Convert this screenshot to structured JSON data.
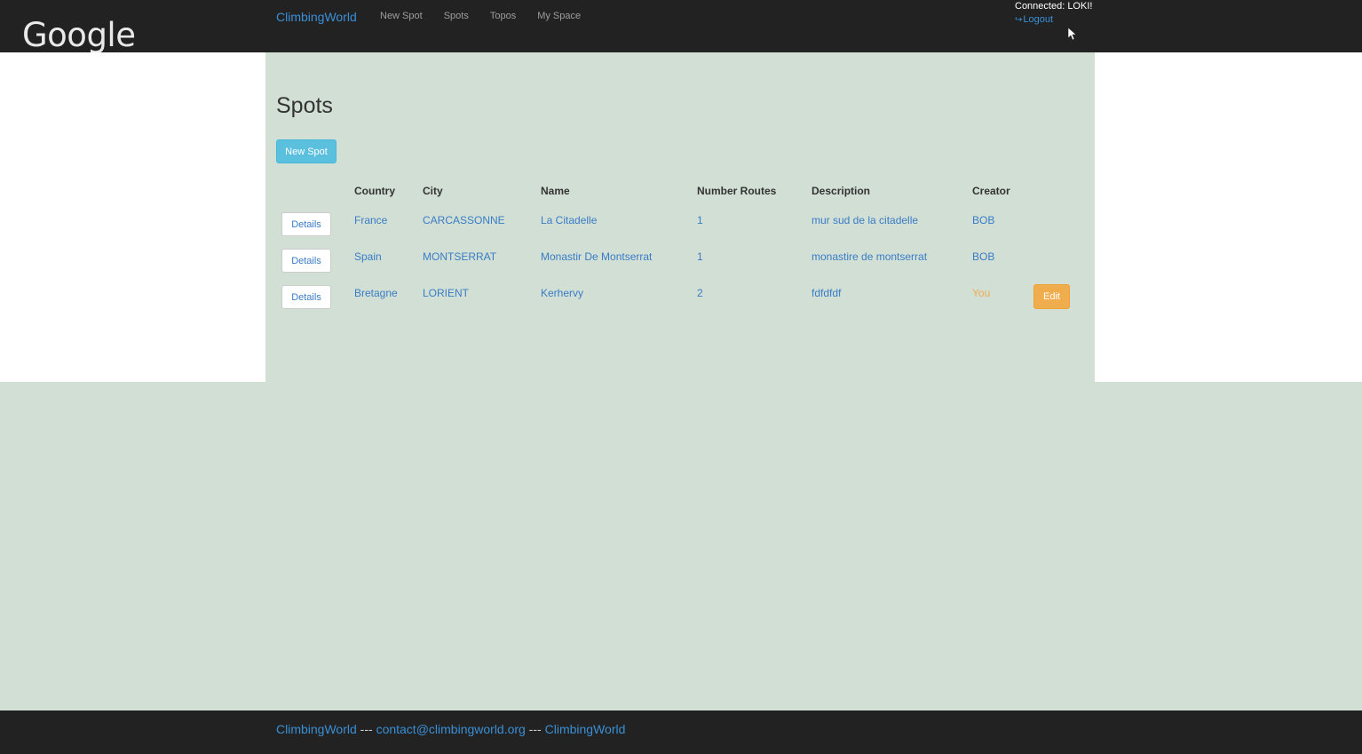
{
  "navbar": {
    "logo": "Google",
    "brand": "ClimbingWorld",
    "links": [
      "New Spot",
      "Spots",
      "Topos",
      "My Space"
    ],
    "connected": "Connected: LOKI!",
    "logout": "Logout"
  },
  "main": {
    "title": "Spots",
    "new_button": "New Spot",
    "table": {
      "headers": [
        "Country",
        "City",
        "Name",
        "Number Routes",
        "Description",
        "Creator"
      ],
      "details_label": "Details",
      "edit_label": "Edit",
      "rows": [
        {
          "country": "France",
          "city": "CARCASSONNE",
          "name": "La Citadelle",
          "routes": "1",
          "description": "mur sud de la citadelle",
          "creator": "BOB"
        },
        {
          "country": "Spain",
          "city": "MONTSERRAT",
          "name": "Monastir De Montserrat",
          "routes": "1",
          "description": "monastire de montserrat",
          "creator": "BOB"
        },
        {
          "country": "Bretagne",
          "city": "LORIENT",
          "name": "Kerhervy",
          "routes": "2",
          "description": "fdfdfdf",
          "creator": "You"
        }
      ]
    }
  },
  "footer": {
    "brand_left": "ClimbingWorld",
    "separator": "---",
    "email": "contact@climbingworld.org",
    "brand_right": "ClimbingWorld"
  },
  "colors": {
    "navbar_bg": "#222222",
    "page_bg": "#d1dfd5",
    "link": "#3a7cc5",
    "info_button": "#5bc0de",
    "warning": "#f0ad4e"
  },
  "icons": {
    "logout": "logout-icon",
    "cursor": "mouse-cursor-icon"
  }
}
